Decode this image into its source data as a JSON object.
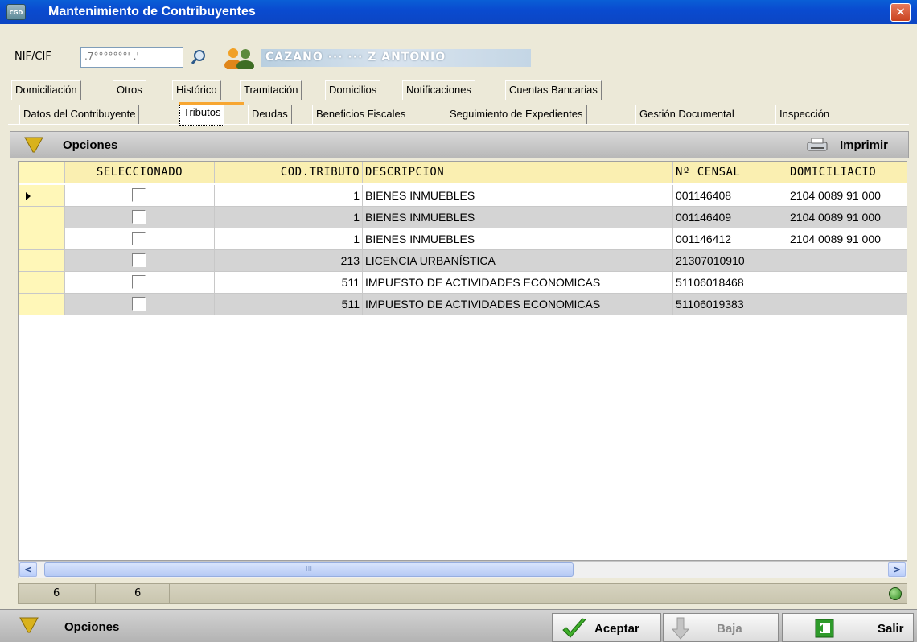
{
  "window": {
    "title": "Mantenimiento de Contribuyentes",
    "close": "✕",
    "app_icon_text": "CGD"
  },
  "identity": {
    "nif_label": "NIF/CIF",
    "nif_value": ".7°°°°°°°' .'",
    "name": "CAZANO ··· ··· Z ANTONIO"
  },
  "tabs_row1": [
    "Domiciliación",
    "Otros",
    "Histórico",
    "Tramitación",
    "Domicilios",
    "Notificaciones",
    "Cuentas Bancarias"
  ],
  "tabs_row2": [
    "Datos del Contribuyente",
    "Tributos",
    "Deudas",
    "Beneficios Fiscales",
    "Seguimiento de Expedientes",
    "Gestión Documental",
    "Inspección"
  ],
  "active_tab": "Tributos",
  "toolbar": {
    "options_label": "Opciones",
    "print_label": "Imprimir"
  },
  "table": {
    "headers": [
      "SELECCIONADO",
      "COD.TRIBUTO",
      "DESCRIPCION",
      "Nº CENSAL",
      "DOMICILIACIO"
    ],
    "rows": [
      {
        "cod": "1",
        "descripcion": "BIENES  INMUEBLES",
        "censal": "001146408",
        "domiciliacion": "2104 0089 91 000"
      },
      {
        "cod": "1",
        "descripcion": "BIENES  INMUEBLES",
        "censal": "001146409",
        "domiciliacion": "2104 0089 91 000"
      },
      {
        "cod": "1",
        "descripcion": "BIENES  INMUEBLES",
        "censal": "001146412",
        "domiciliacion": "2104 0089 91 000"
      },
      {
        "cod": "213",
        "descripcion": "LICENCIA URBANÍSTICA",
        "censal": "21307010910",
        "domiciliacion": ""
      },
      {
        "cod": "511",
        "descripcion": "IMPUESTO DE ACTIVIDADES ECONOMICAS",
        "censal": "51106018468",
        "domiciliacion": ""
      },
      {
        "cod": "511",
        "descripcion": "IMPUESTO DE ACTIVIDADES ECONOMICAS",
        "censal": "51106019383",
        "domiciliacion": ""
      }
    ]
  },
  "scrollbar": {
    "left": "<",
    "right": ">",
    "grip": "III"
  },
  "status": {
    "count1": "6",
    "count2": "6"
  },
  "bottom": {
    "options_label": "Opciones",
    "accept_label": "Aceptar",
    "delete_label": "Baja",
    "exit_label": "Salir"
  },
  "colors": {
    "title_bar": "#0a4bd0",
    "header_row": "#faefb1",
    "alt_row": "#d4d4d4",
    "accent_tab": "#f7a631"
  }
}
